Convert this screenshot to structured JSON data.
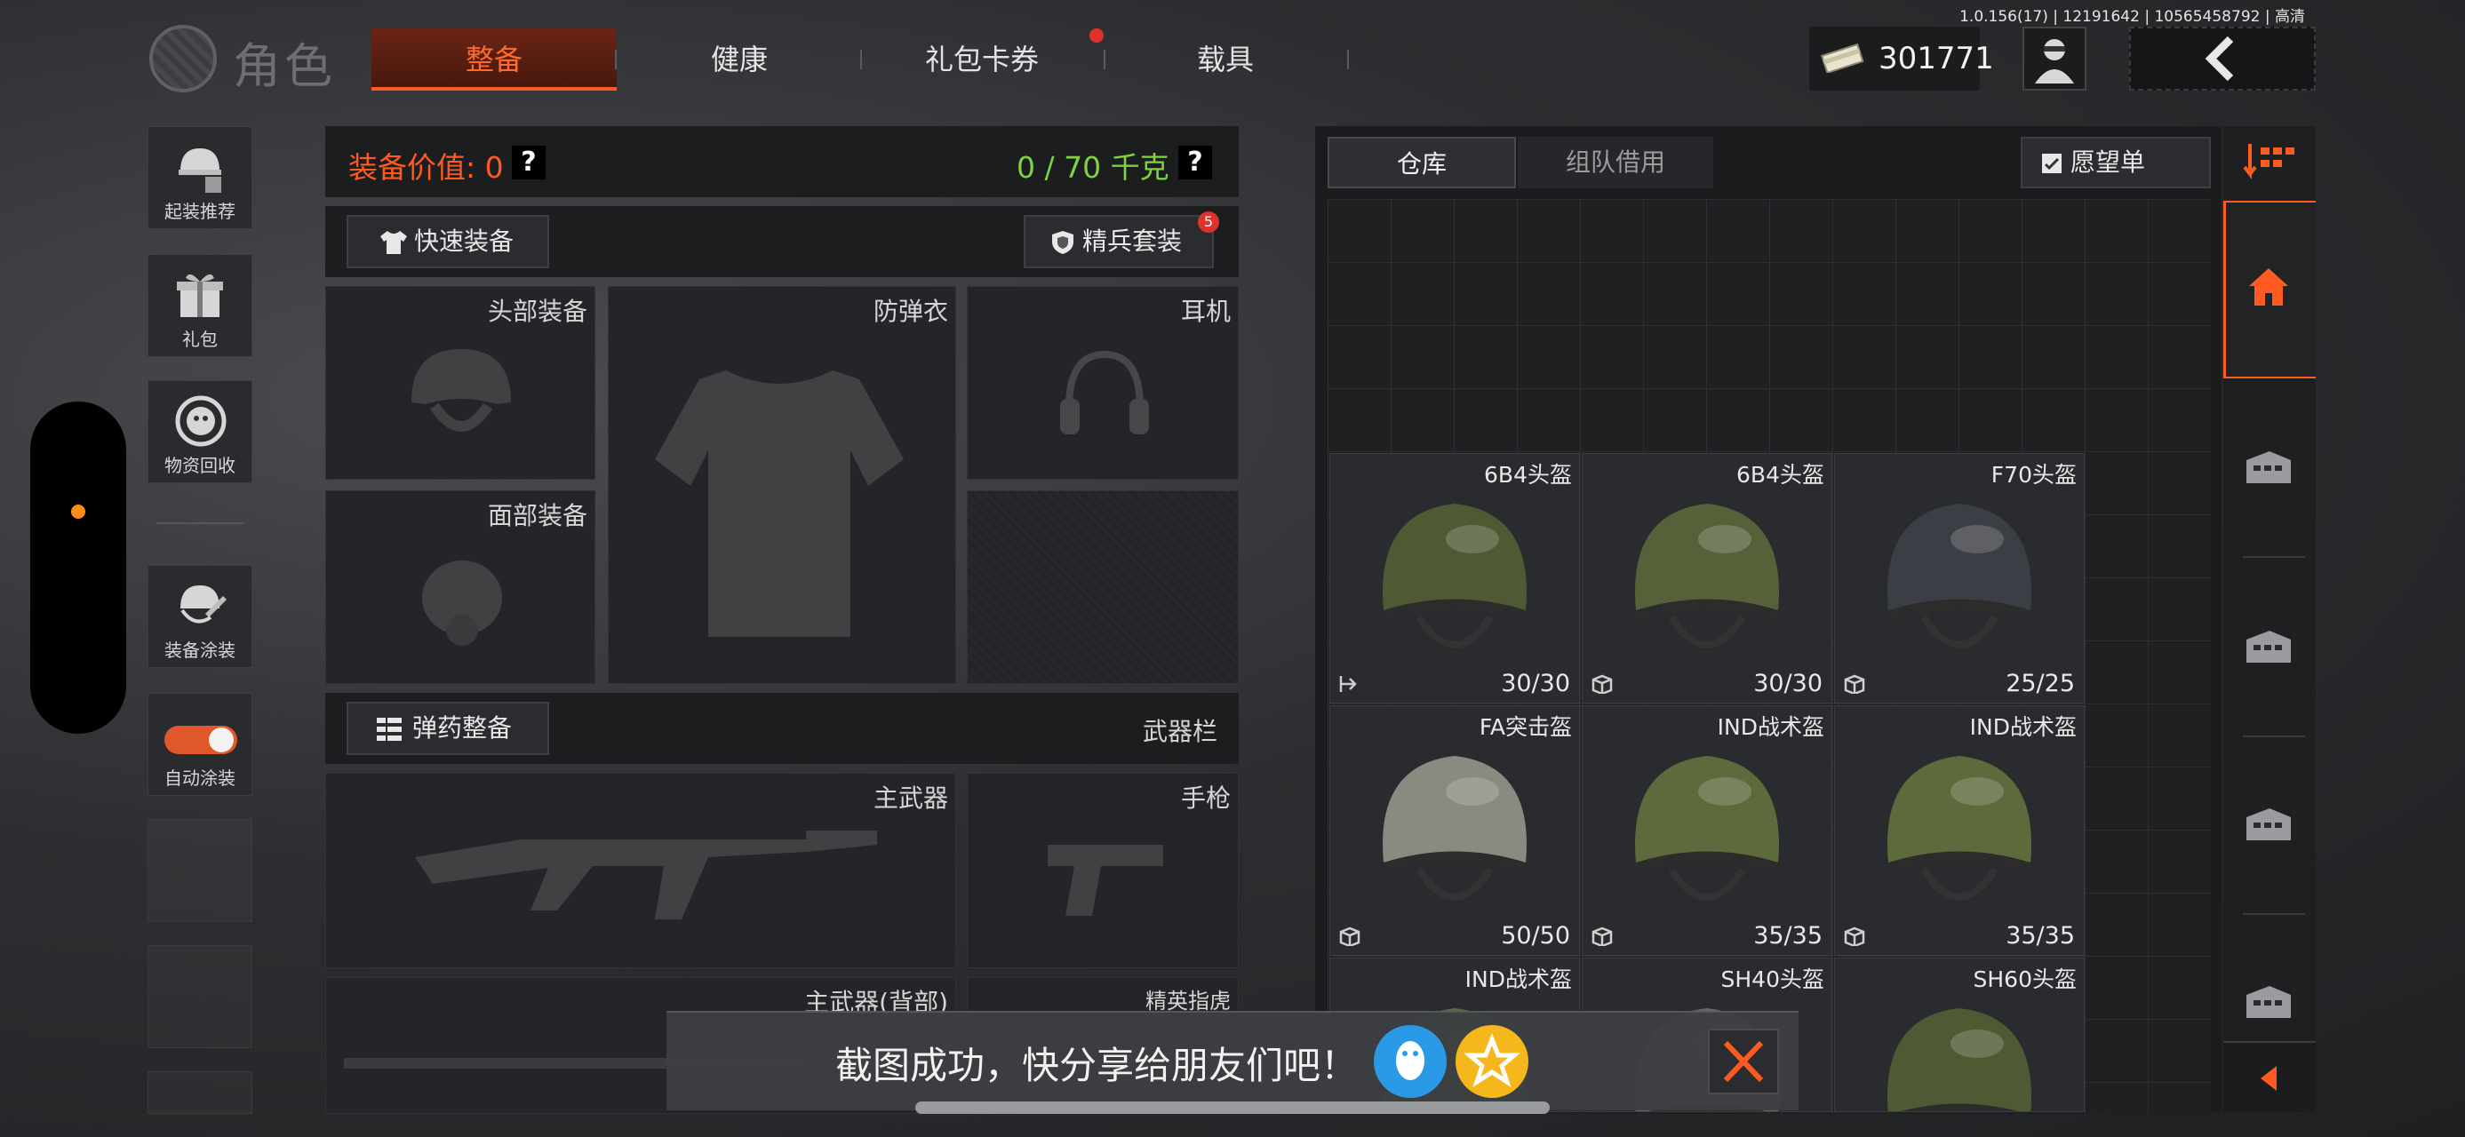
{
  "version_info": "1.0.156(17) | 12191642 | 10565458792 | 高清",
  "header": {
    "title": "角色",
    "tabs": [
      {
        "label": "整备",
        "active": true
      },
      {
        "label": "健康",
        "active": false
      },
      {
        "label": "礼包卡券",
        "active": false,
        "notification": true
      },
      {
        "label": "载具",
        "active": false
      }
    ],
    "currency": "301771"
  },
  "sidebar": {
    "items": [
      {
        "label": "起装推荐",
        "icon": "helmet-recommend-icon"
      },
      {
        "label": "礼包",
        "icon": "gift-icon"
      },
      {
        "label": "物资回收",
        "icon": "recycle-icon"
      },
      {
        "label": "装备涂装",
        "icon": "paint-icon"
      },
      {
        "label": "自动涂装",
        "icon": "toggle-icon",
        "toggle_on": true
      }
    ]
  },
  "equipment": {
    "value_label": "装备价值: 0",
    "weight_label": "0 / 70 千克",
    "quick_equip": "快速装备",
    "elite_kit": "精兵套装",
    "elite_badge": "5",
    "slots": {
      "head": "头部装备",
      "armor": "防弹衣",
      "headset": "耳机",
      "face": "面部装备"
    },
    "ammo_button": "弹药整备",
    "weapon_bar": "武器栏",
    "weapon_slots": {
      "primary": "主武器",
      "pistol": "手枪",
      "primary_back": "主武器(背部)",
      "elite_knuckle": "精英指虎"
    }
  },
  "warehouse": {
    "tabs": [
      {
        "label": "仓库",
        "active": true
      },
      {
        "label": "组队借用",
        "active": false
      }
    ],
    "wishlist": "愿望单",
    "items": [
      {
        "name": "6B4头盔",
        "count": "30/30",
        "color": "#4f5a34"
      },
      {
        "name": "6B4头盔",
        "count": "30/30",
        "color": "#56613a"
      },
      {
        "name": "F70头盔",
        "count": "25/25",
        "color": "#3b3e44"
      },
      {
        "name": "FA突击盔",
        "count": "50/50",
        "color": "#8a8a80"
      },
      {
        "name": "IND战术盔",
        "count": "35/35",
        "color": "#5c6a3c"
      },
      {
        "name": "IND战术盔",
        "count": "35/35",
        "color": "#5c6a3c"
      },
      {
        "name": "IND战术盔",
        "count": "",
        "color": "#5c6a3c"
      },
      {
        "name": "SH40头盔",
        "count": "",
        "color": "#6a6866"
      },
      {
        "name": "SH60头盔",
        "count": "",
        "color": "#4f5a34"
      }
    ]
  },
  "toast": {
    "text": "截图成功，快分享给朋友们吧！"
  },
  "colors": {
    "accent": "#ff5a1f",
    "weight_green": "#7ed33f",
    "orange_dot": "#ff8c1a"
  }
}
